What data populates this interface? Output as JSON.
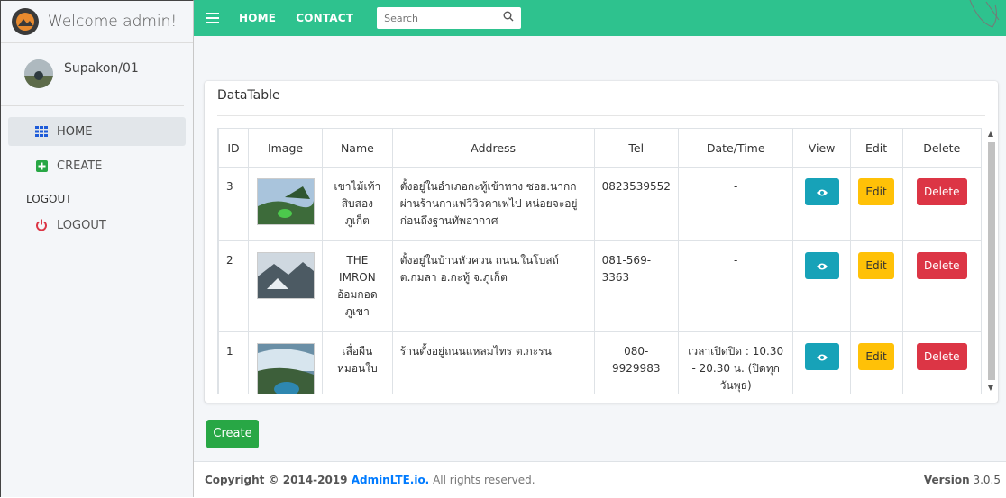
{
  "brand": {
    "title": "Welcome admin!"
  },
  "user": {
    "name": "Supakon/01"
  },
  "sidebar": {
    "items": [
      {
        "label": "HOME",
        "icon": "grid-icon",
        "active": true
      },
      {
        "label": "CREATE",
        "icon": "plus-square-icon",
        "active": false
      }
    ],
    "header": "LOGOUT",
    "logout_label": "LOGOUT"
  },
  "topbar": {
    "links": [
      "HOME",
      "CONTACT"
    ],
    "search_placeholder": "Search"
  },
  "card": {
    "title": "DataTable",
    "columns": [
      "ID",
      "Image",
      "Name",
      "Address",
      "Tel",
      "Date/Time",
      "View",
      "Edit",
      "Delete"
    ],
    "rows": [
      {
        "id": "3",
        "name": "เขาไม้เท้าสิบสอง ภูเก็ต",
        "address": "ตั้งอยู่ในอำเภอกะทู้เข้าทาง ซอย.นากก ผ่านร้านกาแฟวิวิวคาเฟไป หน่อยจะอยู่ก่อนถึงฐานทัพอากาศ",
        "tel": "0823539552",
        "datetime": "-",
        "edit_label": "Edit",
        "delete_label": "Delete"
      },
      {
        "id": "2",
        "name": "THE IMRON อ้อมกอด ภูเขา",
        "address": "ตั้งอยู่ในบ้านหัวควน ถนน.ในโบสถ์ ต.กมลา อ.กะทู้ จ.ภูเก็ต",
        "tel": "081-569-3363",
        "datetime": "-",
        "edit_label": "Edit",
        "delete_label": "Delete"
      },
      {
        "id": "1",
        "name": "เลื่อผืน หมอนใบ",
        "address": "ร้านตั้งอยู่ถนนแหลมไทร ต.กะรน",
        "tel": "080-9929983",
        "datetime": "เวลาเปิดปิด : 10.30 - 20.30 น. (ปิดทุกวันพุธ)",
        "edit_label": "Edit",
        "delete_label": "Delete"
      }
    ]
  },
  "create_label": "Create",
  "footer": {
    "copyright_prefix": "Copyright © 2014-2019 ",
    "brand": "AdminLTE.io.",
    "suffix": " All rights reserved.",
    "version_label": "Version",
    "version": "3.0.5"
  },
  "colors": {
    "topbar": "#2ec28e",
    "view": "#17a2b8",
    "edit": "#ffc107",
    "delete": "#dc3545",
    "create": "#28a745",
    "footer_link": "#007bff"
  }
}
